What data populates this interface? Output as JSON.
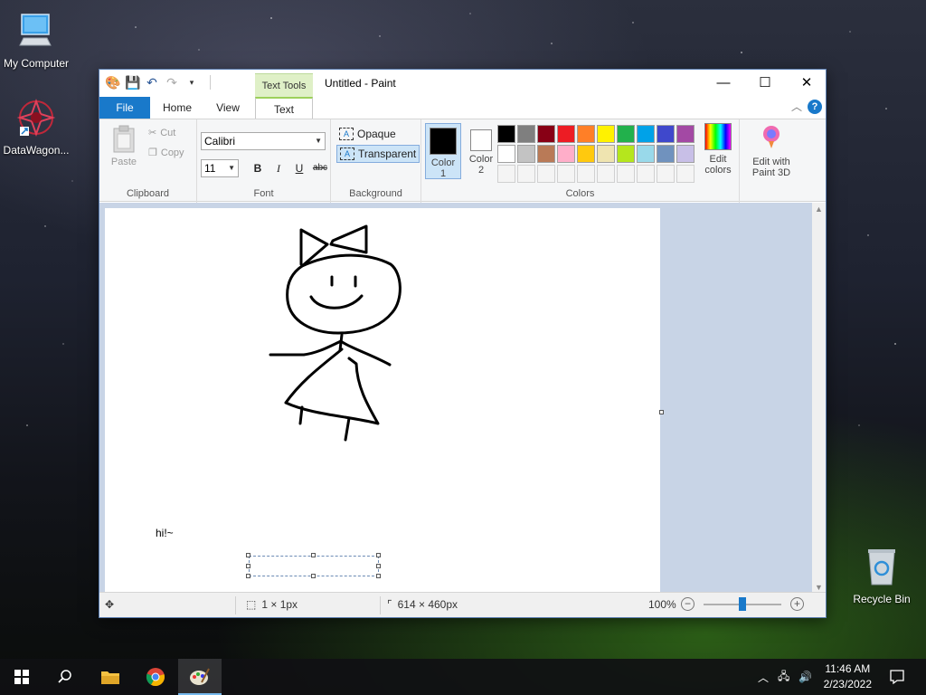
{
  "desktop": {
    "icons": [
      {
        "label": "My Computer",
        "icon": "computer-icon"
      },
      {
        "label": "DataWagon...",
        "icon": "datawagon-icon"
      },
      {
        "label": "Recycle Bin",
        "icon": "recycle-bin-icon"
      }
    ]
  },
  "window": {
    "title": "Untitled - Paint",
    "contextual_tab_header": "Text Tools",
    "controls": {
      "minimize": "—",
      "maximize": "☐",
      "close": "✕"
    }
  },
  "tabs": {
    "file": "File",
    "home": "Home",
    "view": "View",
    "text": "Text"
  },
  "ribbon": {
    "clipboard": {
      "label": "Clipboard",
      "paste": "Paste",
      "cut": "Cut",
      "copy": "Copy"
    },
    "font": {
      "label": "Font",
      "family": "Calibri",
      "size": "11",
      "bold": "B",
      "italic": "I",
      "underline": "U",
      "strike": "abc"
    },
    "background": {
      "label": "Background",
      "opaque": "Opaque",
      "transparent": "Transparent",
      "selected": "Transparent"
    },
    "colors": {
      "label": "Colors",
      "color1_label": "Color",
      "color1_num": "1",
      "color2_label": "Color",
      "color2_num": "2",
      "color1": "#000000",
      "color2": "#ffffff",
      "edit_colors_1": "Edit",
      "edit_colors_2": "colors",
      "palette_row1": [
        "#000000",
        "#7f7f7f",
        "#880015",
        "#ed1c24",
        "#ff7f27",
        "#fff200",
        "#22b14c",
        "#00a2e8",
        "#3f48cc",
        "#a349a4"
      ],
      "palette_row2": [
        "#ffffff",
        "#c3c3c3",
        "#b97a57",
        "#ffaec9",
        "#ffc90e",
        "#efe4b0",
        "#b5e61d",
        "#99d9ea",
        "#7092be",
        "#c8bfe7"
      ]
    },
    "paint3d": {
      "line1": "Edit with",
      "line2": "Paint 3D"
    }
  },
  "canvas": {
    "text": "hi!~"
  },
  "statusbar": {
    "selection_size": "1 × 1px",
    "image_size": "614 × 460px",
    "zoom": "100%",
    "zoom_level": 1.0
  },
  "taskbar": {
    "time": "11:46 AM",
    "date": "2/23/2022"
  }
}
